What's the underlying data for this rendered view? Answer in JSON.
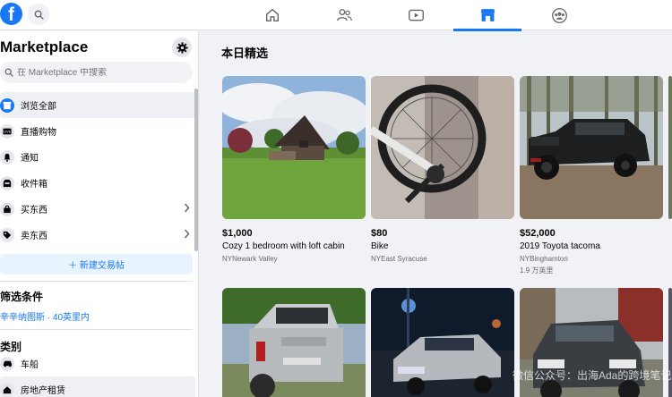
{
  "search": {
    "placeholder": "在 Marketplace 中搜索"
  },
  "sidebar": {
    "title": "Marketplace",
    "items": [
      {
        "label": "浏览全部"
      },
      {
        "label": "直播购物"
      },
      {
        "label": "通知"
      },
      {
        "label": "收件箱"
      },
      {
        "label": "买东西"
      },
      {
        "label": "卖东西"
      }
    ],
    "new_listing": "＋ 新建交易帖",
    "filters_title": "筛选条件",
    "filters_location": "辛辛纳图斯 · 40英里内",
    "categories_title": "类别",
    "categories": [
      {
        "label": "车船"
      },
      {
        "label": "房地产租赁"
      }
    ]
  },
  "main": {
    "title": "本日精选",
    "listings": [
      {
        "price": "$1,000",
        "title": "Cozy 1 bedroom with loft cabin",
        "location": "NYNewark Valley"
      },
      {
        "price": "$80",
        "title": "Bike",
        "location": "NYEast Syracuse"
      },
      {
        "price": "$52,000",
        "title": "2019 Toyota tacoma",
        "location": "NYBinghamton",
        "miles": "1.9 万英里"
      }
    ]
  },
  "watermark": "微信公众号：出海Ada的跨境笔记",
  "colors": {
    "brand": "#1877f2",
    "active_bg": "#eef0f3",
    "link": "#1877f2"
  }
}
